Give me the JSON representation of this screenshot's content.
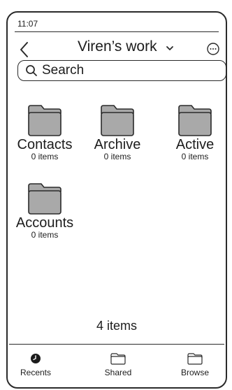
{
  "status": {
    "time": "11:07"
  },
  "header": {
    "title": "Viren’s work"
  },
  "search": {
    "placeholder": "Search"
  },
  "folders": [
    {
      "name": "Contacts",
      "count": "0 items"
    },
    {
      "name": "Archive",
      "count": "0 items"
    },
    {
      "name": "Active",
      "count": "0 items"
    },
    {
      "name": "Accounts",
      "count": "0 items"
    }
  ],
  "footer": {
    "total": "4 items"
  },
  "tabs": [
    {
      "label": "Recents",
      "icon": "clock-icon"
    },
    {
      "label": "Shared",
      "icon": "folder-icon"
    },
    {
      "label": "Browse",
      "icon": "folder-icon"
    }
  ],
  "colors": {
    "folder_fill": "#a9a9a9",
    "stroke": "#2a2a2a"
  }
}
